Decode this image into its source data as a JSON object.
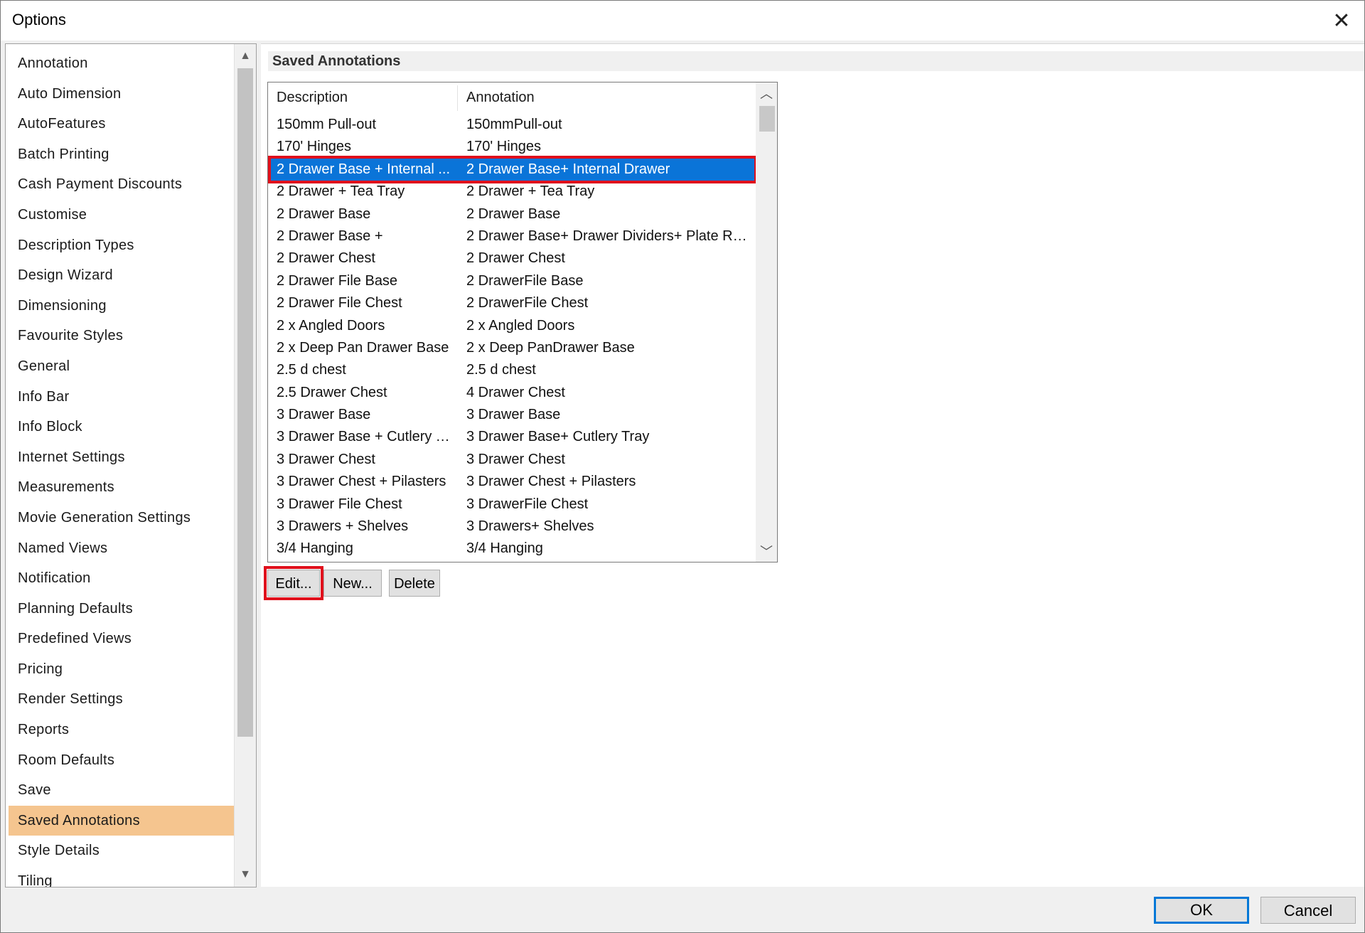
{
  "window": {
    "title": "Options"
  },
  "nav": {
    "items": [
      "Annotation",
      "Auto Dimension",
      "AutoFeatures",
      "Batch Printing",
      "Cash Payment Discounts",
      "Customise",
      "Description Types",
      "Design Wizard",
      "Dimensioning",
      "Favourite Styles",
      "General",
      "Info Bar",
      "Info Block",
      "Internet Settings",
      "Measurements",
      "Movie Generation Settings",
      "Named Views",
      "Notification",
      "Planning Defaults",
      "Predefined Views",
      "Pricing",
      "Render Settings",
      "Reports",
      "Room Defaults",
      "Save",
      "Saved Annotations",
      "Style Details",
      "Tiling"
    ],
    "selected": "Saved Annotations"
  },
  "panel": {
    "header": "Saved Annotations",
    "columns": [
      "Description",
      "Annotation"
    ],
    "rows": [
      [
        "150mm Pull-out",
        "150mmPull-out"
      ],
      [
        "170' Hinges",
        "170' Hinges"
      ],
      [
        "2  Drawer Base + Internal ...",
        "2  Drawer Base+ Internal Drawer"
      ],
      [
        "2 Drawer + Tea Tray",
        "2 Drawer + Tea Tray"
      ],
      [
        "2 Drawer Base",
        "2  Drawer Base"
      ],
      [
        "2 Drawer Base +",
        "2 Drawer Base+ Drawer Dividers+ Plate Ra..."
      ],
      [
        "2 Drawer Chest",
        "2 Drawer Chest"
      ],
      [
        "2 Drawer File Base",
        "2 DrawerFile Base"
      ],
      [
        "2 Drawer File Chest",
        "2 DrawerFile Chest"
      ],
      [
        "2 x Angled Doors",
        "2 x Angled Doors"
      ],
      [
        "2 x Deep Pan Drawer Base",
        "2 x Deep PanDrawer Base"
      ],
      [
        "2.5 d chest",
        "2.5 d chest"
      ],
      [
        "2.5 Drawer Chest",
        "4 Drawer Chest"
      ],
      [
        "3 Drawer Base",
        "3 Drawer Base"
      ],
      [
        "3 Drawer Base + Cutlery Tr...",
        "3 Drawer Base+ Cutlery Tray"
      ],
      [
        "3 Drawer Chest",
        "3 Drawer Chest"
      ],
      [
        "3 Drawer Chest + Pilasters",
        "3 Drawer Chest + Pilasters"
      ],
      [
        "3 Drawer File Chest",
        "3 DrawerFile Chest"
      ],
      [
        "3 Drawers + Shelves",
        "3 Drawers+ Shelves"
      ],
      [
        "3/4 Hanging",
        "3/4 Hanging"
      ]
    ],
    "selected_row": 2,
    "buttons": {
      "edit": "Edit...",
      "new": "New...",
      "delete": "Delete"
    }
  },
  "footer": {
    "ok": "OK",
    "cancel": "Cancel"
  },
  "colors": {
    "selection": "#0a74d8",
    "nav_selected": "#f5c58f",
    "highlight": "#e0101c"
  }
}
